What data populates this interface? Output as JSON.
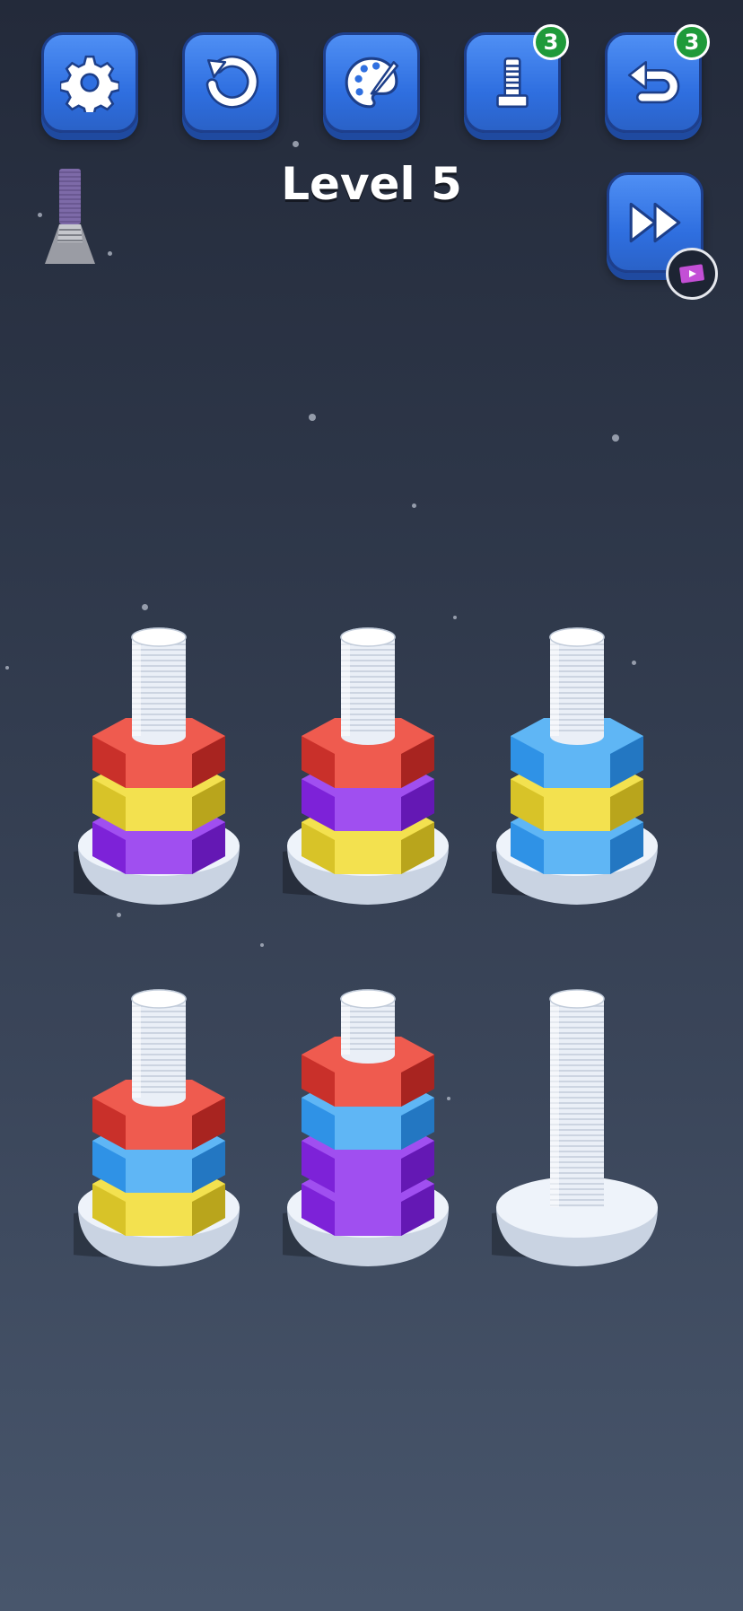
{
  "level": {
    "title": "Level 5"
  },
  "toolbar": {
    "settings_icon": "gear-icon",
    "restart_icon": "restart-icon",
    "theme_icon": "palette-icon",
    "extra_bolt": {
      "icon": "bolt-icon",
      "count": "3"
    },
    "undo": {
      "icon": "undo-icon",
      "count": "3"
    }
  },
  "skip": {
    "icon": "fast-forward-icon",
    "ad_icon": "video-ad-icon"
  },
  "colors": {
    "red": "#e0413a",
    "yellow": "#e9d63a",
    "purple": "#8f2ee6",
    "blue": "#3aa0ef",
    "bolt": "#eef2f8",
    "button": "#3a7cea"
  },
  "stacks": [
    {
      "nuts": [
        "purple",
        "yellow",
        "red"
      ]
    },
    {
      "nuts": [
        "yellow",
        "purple",
        "red"
      ]
    },
    {
      "nuts": [
        "blue",
        "yellow",
        "blue"
      ]
    },
    {
      "nuts": [
        "yellow",
        "blue",
        "red"
      ]
    },
    {
      "nuts": [
        "purple",
        "purple",
        "blue",
        "red"
      ]
    },
    {
      "nuts": []
    }
  ]
}
